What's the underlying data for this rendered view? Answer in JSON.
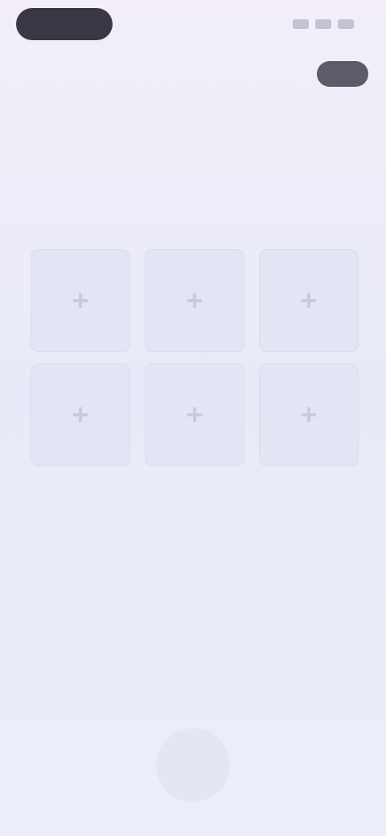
{
  "status_bar": {
    "time": "",
    "icons": [
      "signal-icon",
      "wifi-icon",
      "battery-icon"
    ]
  },
  "nav": {
    "title": "",
    "action_label": ""
  },
  "content": {
    "title": "",
    "description": ""
  },
  "photo_slots": [
    {
      "icon": "plus-icon",
      "glyph": "+"
    },
    {
      "icon": "plus-icon",
      "glyph": "+"
    },
    {
      "icon": "plus-icon",
      "glyph": "+"
    },
    {
      "icon": "plus-icon",
      "glyph": "+"
    },
    {
      "icon": "plus-icon",
      "glyph": "+"
    },
    {
      "icon": "plus-icon",
      "glyph": "+"
    }
  ],
  "colors": {
    "background_top": "#f3eef9",
    "background_bottom": "#ebeef9",
    "time_pill": "#3a3744",
    "action_button": "#5e5b69",
    "slot_fill": "#e1e5f4"
  }
}
